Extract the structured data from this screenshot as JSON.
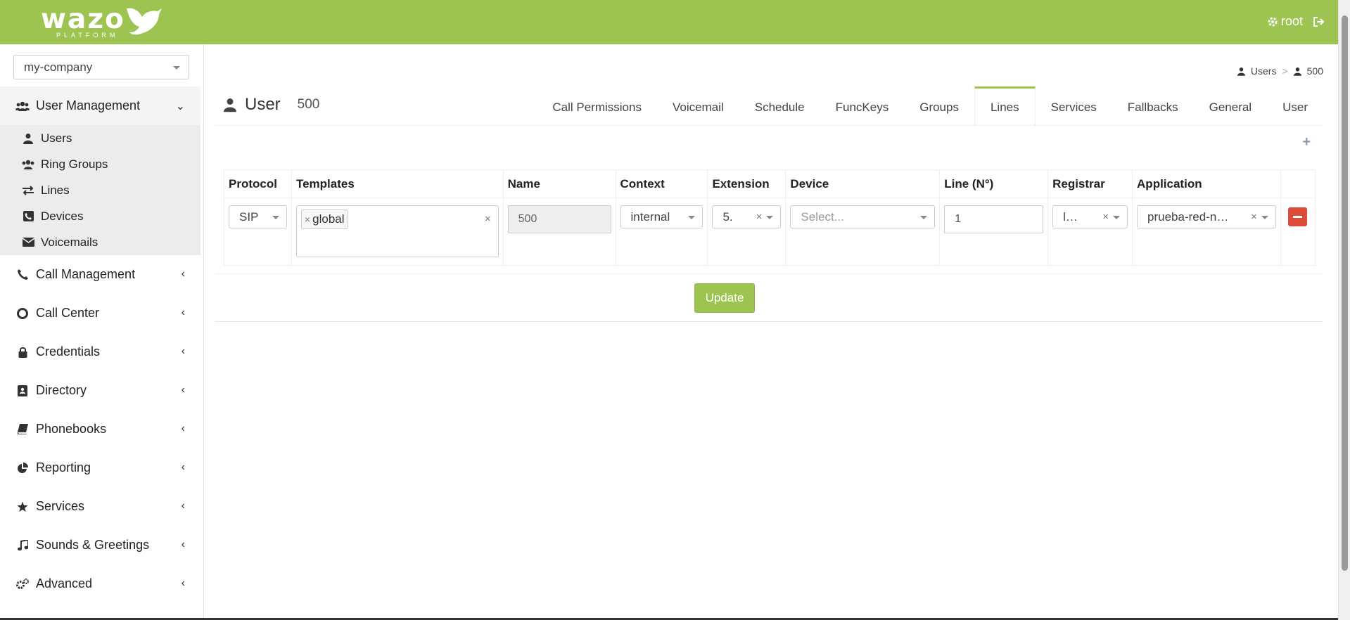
{
  "header": {
    "logo_text": "wazo",
    "logo_sub": "PLATFORM",
    "user": "root",
    "colors": {
      "brand": "#9dc451",
      "danger": "#dd4b39"
    }
  },
  "sidebar": {
    "tenant": "my-company",
    "groups": [
      {
        "label": "User Management",
        "icon": "users-icon"
      },
      {
        "label": "Call Management",
        "icon": "phone-icon"
      },
      {
        "label": "Call Center",
        "icon": "lifering-icon"
      },
      {
        "label": "Credentials",
        "icon": "lock-icon"
      },
      {
        "label": "Directory",
        "icon": "contact-book-icon"
      },
      {
        "label": "Phonebooks",
        "icon": "book-icon"
      },
      {
        "label": "Reporting",
        "icon": "pie-chart-icon"
      },
      {
        "label": "Services",
        "icon": "star-icon"
      },
      {
        "label": "Sounds & Greetings",
        "icon": "music-icon"
      },
      {
        "label": "Advanced",
        "icon": "cogs-icon"
      }
    ],
    "sub_items": [
      {
        "label": "Users",
        "icon": "user-icon"
      },
      {
        "label": "Ring Groups",
        "icon": "users-icon"
      },
      {
        "label": "Lines",
        "icon": "exchange-icon"
      },
      {
        "label": "Devices",
        "icon": "phone-square-icon"
      },
      {
        "label": "Voicemails",
        "icon": "envelope-icon"
      }
    ]
  },
  "breadcrumb": {
    "item1": "Users",
    "separator": ">",
    "item2": "500"
  },
  "page": {
    "title": "User",
    "number": "500"
  },
  "tabs": [
    "Call Permissions",
    "Voicemail",
    "Schedule",
    "FuncKeys",
    "Groups",
    "Lines",
    "Services",
    "Fallbacks",
    "General",
    "User"
  ],
  "active_tab": "Lines",
  "lines_table": {
    "headers": [
      "Protocol",
      "Templates",
      "Name",
      "Context",
      "Extension",
      "Device",
      "Line (N°)",
      "Registrar",
      "Application"
    ],
    "row": {
      "protocol": "SIP",
      "template_chip": "global",
      "name": "500",
      "context": "internal",
      "extension": "5.",
      "device_placeholder": "Select...",
      "line_number": "1",
      "registrar": "l…",
      "application": "prueba-red-n…"
    }
  },
  "actions": {
    "update_label": "Update",
    "add_label": "+"
  }
}
